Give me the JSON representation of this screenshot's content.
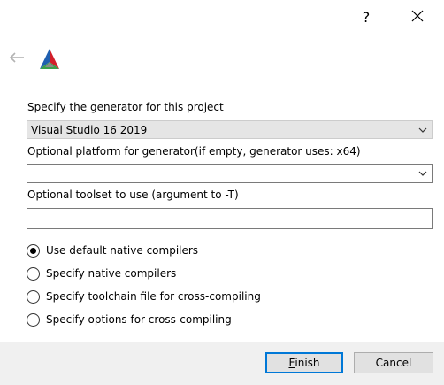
{
  "window": {
    "help_label": "?",
    "close_icon": "close-icon",
    "back_icon": "back-arrow-icon",
    "logo_icon": "cmake-logo-icon"
  },
  "form": {
    "generator": {
      "label": "Specify the generator for this project",
      "value": "Visual Studio 16 2019"
    },
    "platform": {
      "label": "Optional platform for generator(if empty, generator uses: x64)",
      "value": ""
    },
    "toolset": {
      "label": "Optional toolset to use (argument to -T)",
      "value": "",
      "placeholder": ""
    }
  },
  "radios": [
    {
      "label": "Use default native compilers",
      "checked": true
    },
    {
      "label": "Specify native compilers",
      "checked": false
    },
    {
      "label": "Specify toolchain file for cross-compiling",
      "checked": false
    },
    {
      "label": "Specify options for cross-compiling",
      "checked": false
    }
  ],
  "footer": {
    "finish_mnemonic": "F",
    "finish_rest": "inish",
    "cancel_label": "Cancel"
  },
  "colors": {
    "accent": "#0078d7",
    "footer_bg": "#f0f0f0",
    "disabled_combo_bg": "#e5e5e5",
    "back_arrow": "#b3b3b3",
    "logo_red": "#d21f2a",
    "logo_blue": "#1f5fb0",
    "logo_green": "#3aa04a"
  }
}
